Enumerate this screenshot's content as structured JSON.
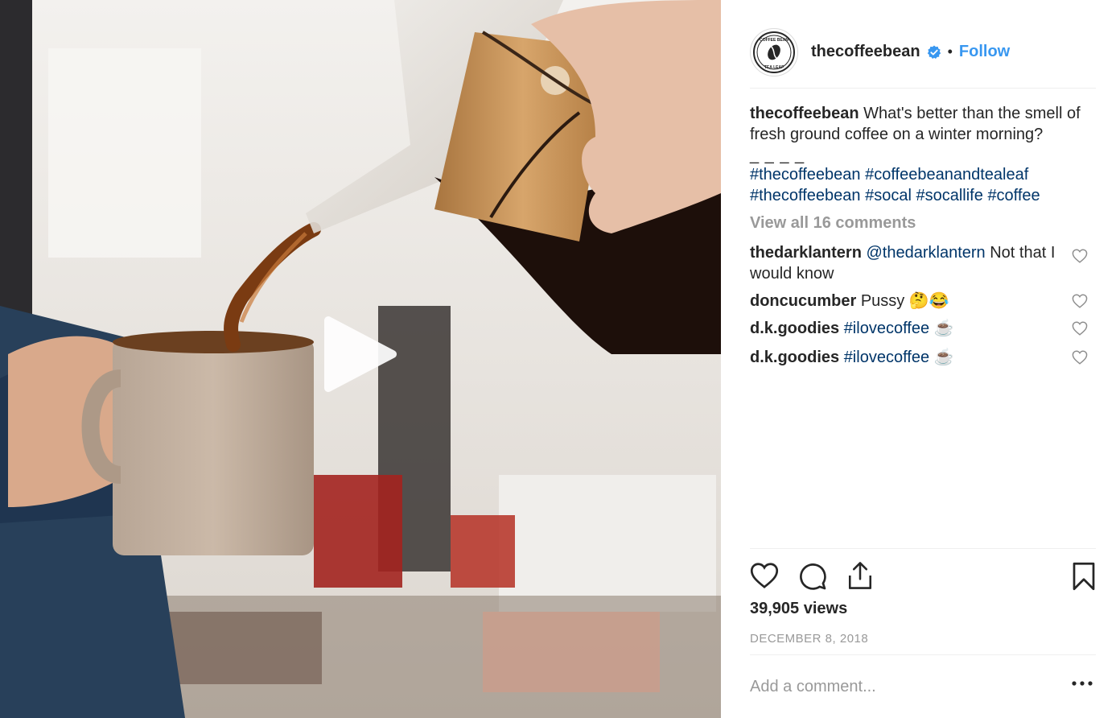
{
  "post": {
    "username": "thecoffeebean",
    "follow_label": "Follow",
    "avatar_text_top": "COFFEE BEAN",
    "avatar_text_bottom": "TEA LEAF",
    "caption_user": "thecoffeebean",
    "caption_text": "What's better than the smell of fresh ground coffee on a winter morning?",
    "caption_divider": "_ _ _ _",
    "hashtags": [
      "#thecoffeebean",
      "#coffeebeanandtealeaf",
      "#thecoffeebean",
      "#socal",
      "#socallife",
      "#coffee"
    ],
    "view_all_comments": "View all 16 comments",
    "views": "39,905 views",
    "date": "DECEMBER 8, 2018",
    "add_comment_placeholder": "Add a comment..."
  },
  "comments": [
    {
      "user": "thedarklantern",
      "mention": "@thedarklantern",
      "text": "Not that I would know"
    },
    {
      "user": "doncucumber",
      "mention": "",
      "text": "Pussy 🤔😂"
    },
    {
      "user": "d.k.goodies",
      "mention": "#ilovecoffee",
      "text": "☕"
    },
    {
      "user": "d.k.goodies",
      "mention": "#ilovecoffee",
      "text": "☕"
    }
  ],
  "icons": {
    "like": "heart-icon",
    "comment": "comment-icon",
    "share": "share-icon",
    "save": "bookmark-icon",
    "verified": "verified-badge-icon",
    "play": "play-icon",
    "more": "more-options-icon"
  },
  "colors": {
    "link": "#3897f0",
    "hashtag": "#003569",
    "muted": "#999999",
    "text": "#262626"
  }
}
